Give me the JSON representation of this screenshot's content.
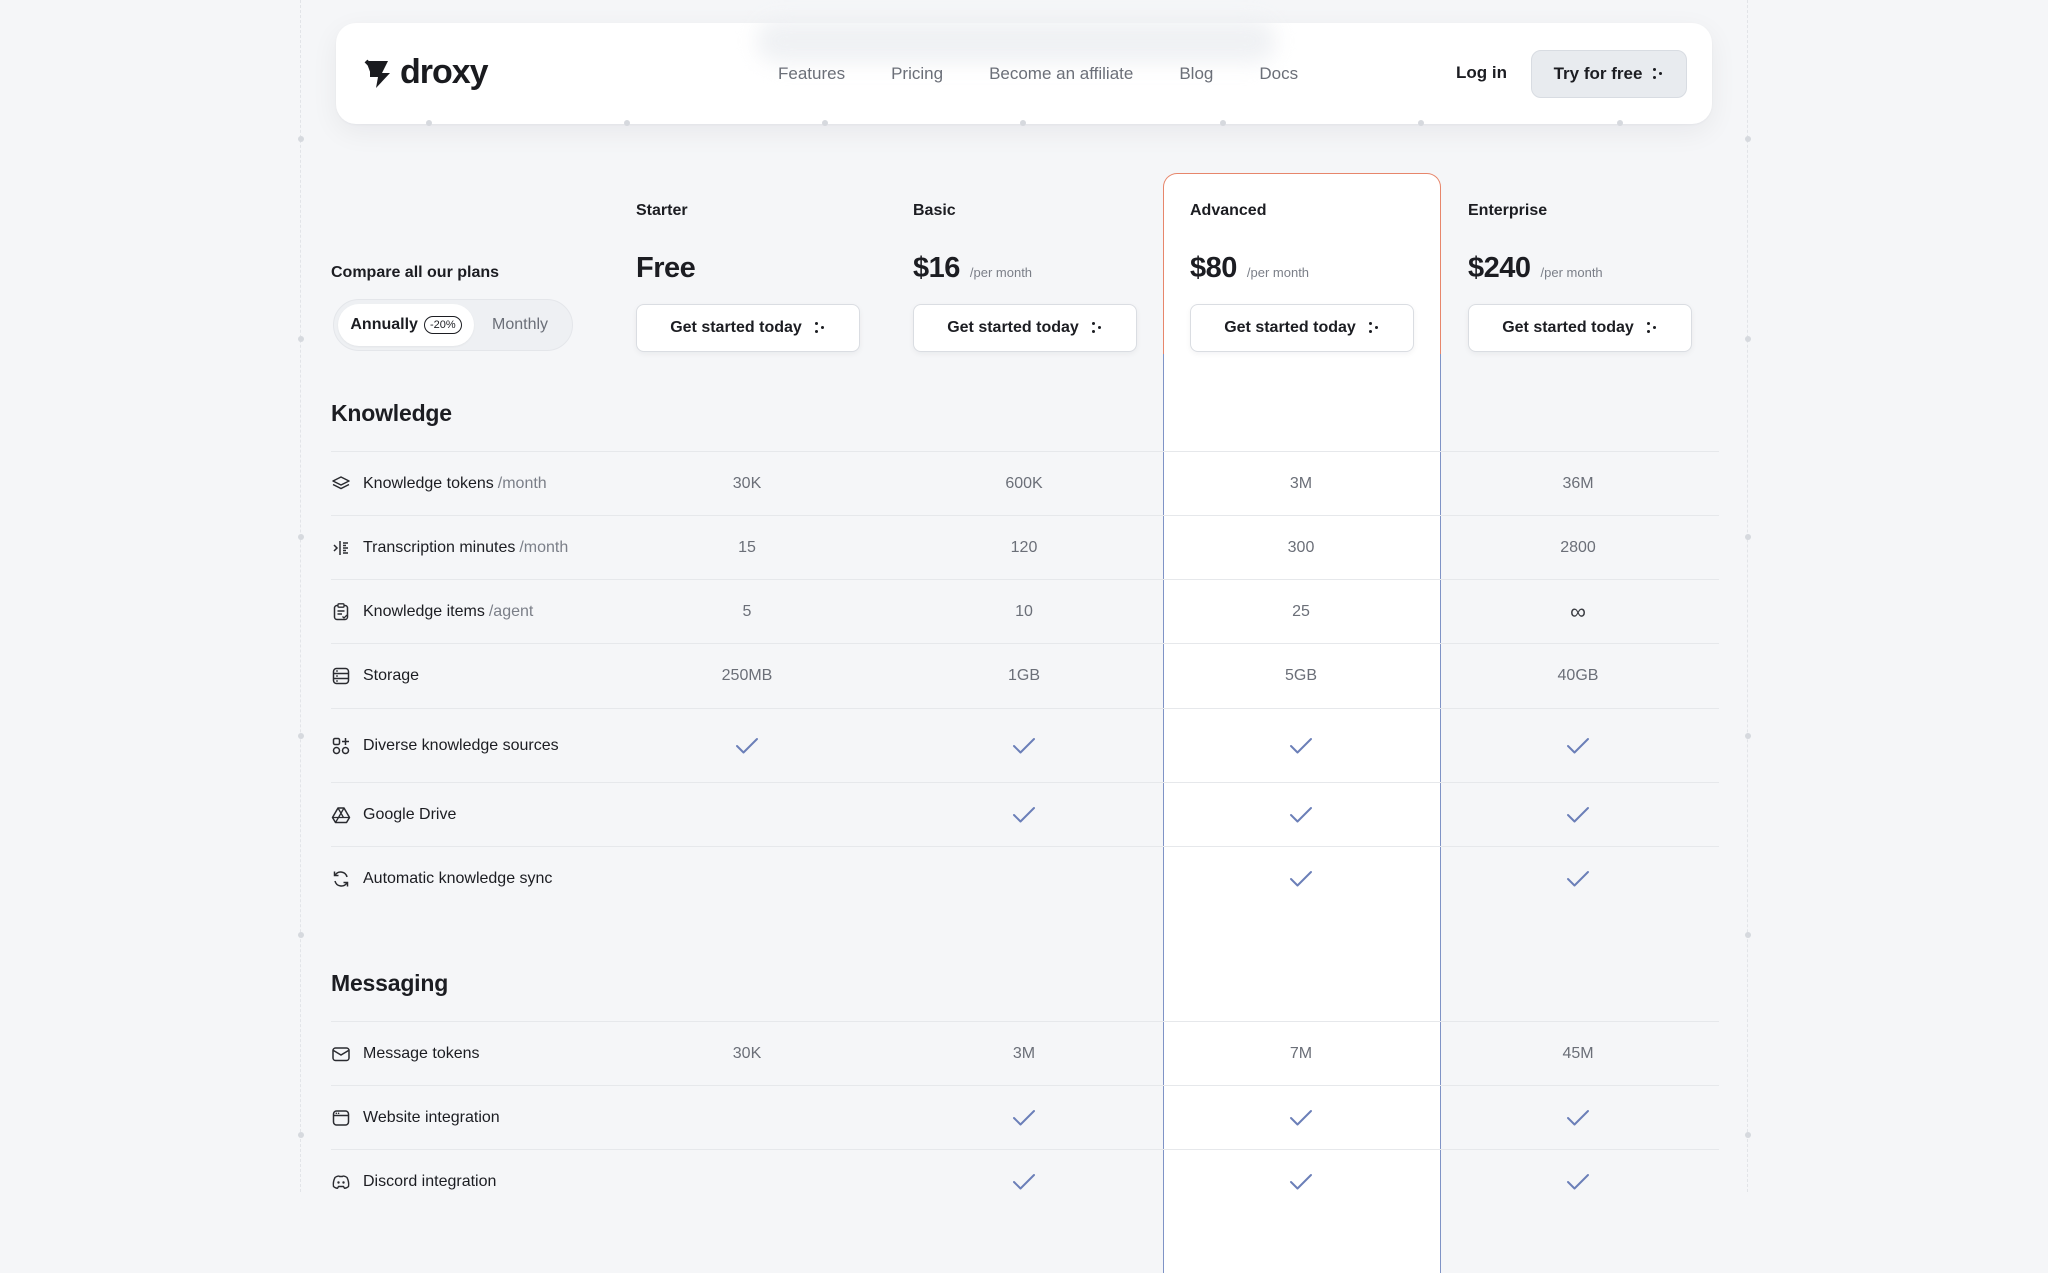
{
  "nav": {
    "logo": "droxy",
    "links": [
      "Features",
      "Pricing",
      "Become an affiliate",
      "Blog",
      "Docs"
    ],
    "login": "Log in",
    "cta": "Try for free"
  },
  "compare": {
    "title": "Compare all our plans",
    "toggle_annual": "Annually",
    "toggle_discount": "-20%",
    "toggle_monthly": "Monthly"
  },
  "plans": [
    {
      "name": "Starter",
      "price": "Free",
      "per": "",
      "cta": "Get started today"
    },
    {
      "name": "Basic",
      "price": "$16",
      "per": "/per month",
      "cta": "Get started today"
    },
    {
      "name": "Advanced",
      "price": "$80",
      "per": "/per month",
      "cta": "Get started today"
    },
    {
      "name": "Enterprise",
      "price": "$240",
      "per": "/per month",
      "cta": "Get started today"
    }
  ],
  "colors": {
    "check": "#6b7fb8",
    "highlight_border_top": "#e7866b",
    "highlight_border_side": "#7f93c6"
  },
  "sections": [
    {
      "title": "Knowledge",
      "rows": [
        {
          "label": "Knowledge tokens",
          "unit": "/month",
          "icon": "layers-icon",
          "values": [
            "30K",
            "600K",
            "3M",
            "36M"
          ]
        },
        {
          "label": "Transcription minutes",
          "unit": "/month",
          "icon": "transcription-icon",
          "values": [
            "15",
            "120",
            "300",
            "2800"
          ]
        },
        {
          "label": "Knowledge items",
          "unit": "/agent",
          "icon": "clipboard-icon",
          "values": [
            "5",
            "10",
            "25",
            "∞"
          ]
        },
        {
          "label": "Storage",
          "unit": "",
          "icon": "storage-icon",
          "values": [
            "250MB",
            "1GB",
            "5GB",
            "40GB"
          ]
        },
        {
          "label": "Diverse knowledge sources",
          "unit": "",
          "icon": "apps-add-icon",
          "values": [
            "check",
            "check",
            "check",
            "check"
          ]
        },
        {
          "label": "Google Drive",
          "unit": "",
          "icon": "google-drive-icon",
          "values": [
            "",
            "check",
            "check",
            "check"
          ]
        },
        {
          "label": "Automatic knowledge sync",
          "unit": "",
          "icon": "sync-icon",
          "values": [
            "",
            "",
            "check",
            "check"
          ]
        }
      ]
    },
    {
      "title": "Messaging",
      "rows": [
        {
          "label": "Message tokens",
          "unit": "",
          "icon": "mail-icon",
          "values": [
            "30K",
            "3M",
            "7M",
            "45M"
          ]
        },
        {
          "label": "Website integration",
          "unit": "",
          "icon": "browser-icon",
          "values": [
            "",
            "check",
            "check",
            "check"
          ]
        },
        {
          "label": "Discord integration",
          "unit": "",
          "icon": "discord-icon",
          "values": [
            "",
            "check",
            "check",
            "check"
          ]
        }
      ]
    }
  ]
}
